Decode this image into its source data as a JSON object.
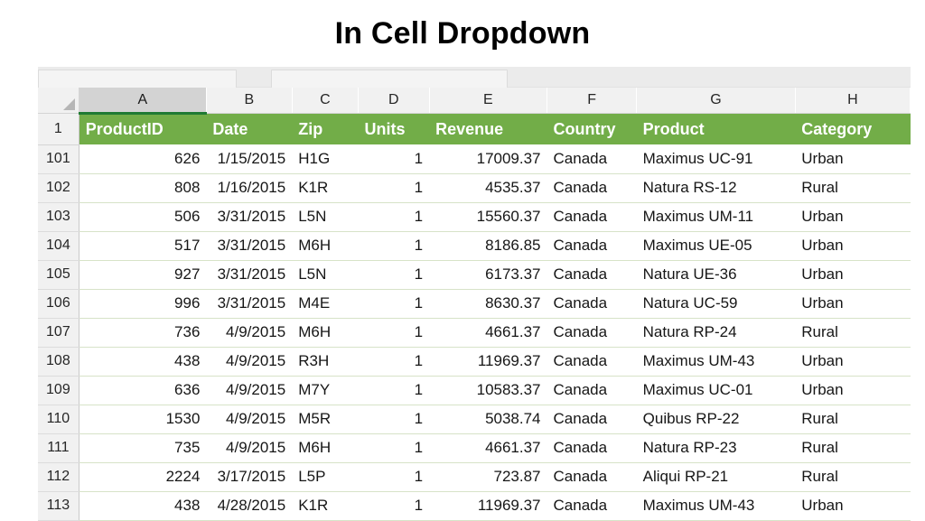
{
  "title": "In Cell Dropdown",
  "spreadsheet": {
    "column_letters": [
      "A",
      "B",
      "C",
      "D",
      "E",
      "F",
      "G",
      "H"
    ],
    "selected_column": "A",
    "header_row_number": "1",
    "headers": [
      "ProductID",
      "Date",
      "Zip",
      "Units",
      "Revenue",
      "Country",
      "Product",
      "Category"
    ],
    "header_fill_color": "#72ad48",
    "header_text_color": "#ffffff",
    "row_numbers": [
      "101",
      "102",
      "103",
      "104",
      "105",
      "106",
      "107",
      "108",
      "109",
      "110",
      "111",
      "112",
      "113"
    ],
    "rows": [
      [
        "626",
        "1/15/2015",
        "H1G",
        "1",
        "17009.37",
        "Canada",
        "Maximus UC-91",
        "Urban"
      ],
      [
        "808",
        "1/16/2015",
        "K1R",
        "1",
        "4535.37",
        "Canada",
        "Natura RS-12",
        "Rural"
      ],
      [
        "506",
        "3/31/2015",
        "L5N",
        "1",
        "15560.37",
        "Canada",
        "Maximus UM-11",
        "Urban"
      ],
      [
        "517",
        "3/31/2015",
        "M6H",
        "1",
        "8186.85",
        "Canada",
        "Maximus UE-05",
        "Urban"
      ],
      [
        "927",
        "3/31/2015",
        "L5N",
        "1",
        "6173.37",
        "Canada",
        "Natura UE-36",
        "Urban"
      ],
      [
        "996",
        "3/31/2015",
        "M4E",
        "1",
        "8630.37",
        "Canada",
        "Natura UC-59",
        "Urban"
      ],
      [
        "736",
        "4/9/2015",
        "M6H",
        "1",
        "4661.37",
        "Canada",
        "Natura RP-24",
        "Rural"
      ],
      [
        "438",
        "4/9/2015",
        "R3H",
        "1",
        "11969.37",
        "Canada",
        "Maximus UM-43",
        "Urban"
      ],
      [
        "636",
        "4/9/2015",
        "M7Y",
        "1",
        "10583.37",
        "Canada",
        "Maximus UC-01",
        "Urban"
      ],
      [
        "1530",
        "4/9/2015",
        "M5R",
        "1",
        "5038.74",
        "Canada",
        "Quibus RP-22",
        "Rural"
      ],
      [
        "735",
        "4/9/2015",
        "M6H",
        "1",
        "4661.37",
        "Canada",
        "Natura RP-23",
        "Rural"
      ],
      [
        "2224",
        "3/17/2015",
        "L5P",
        "1",
        "723.87",
        "Canada",
        "Aliqui RP-21",
        "Rural"
      ],
      [
        "438",
        "4/28/2015",
        "K1R",
        "1",
        "11969.37",
        "Canada",
        "Maximus UM-43",
        "Urban"
      ]
    ]
  }
}
